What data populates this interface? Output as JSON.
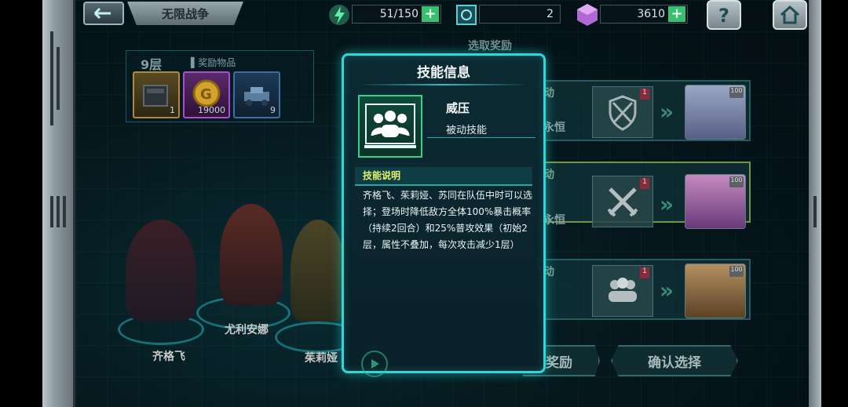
{
  "topbar": {
    "mode_title": "无限战争",
    "energy": "51/150",
    "scan_count": "2",
    "gems": "3610",
    "plus_label": "+"
  },
  "floor_panel": {
    "floor": "9层",
    "rewards_label": "▌奖励物品",
    "items": [
      {
        "icon": "ammo-crate-icon",
        "count": "1"
      },
      {
        "icon": "gold-coin-icon",
        "count": "19000"
      },
      {
        "icon": "tank-part-icon",
        "count": "9"
      }
    ]
  },
  "characters": [
    {
      "name": "齐格飞"
    },
    {
      "name": "尤利安娜"
    },
    {
      "name": "茱莉娅"
    }
  ],
  "choose_reward_header": "选取奖励",
  "choices": [
    {
      "title": "动",
      "sub": "永恒",
      "skill_icon": "crossed-sword-shield-icon"
    },
    {
      "title": "动",
      "sub": "永恒",
      "skill_icon": "crossed-swords-icon"
    },
    {
      "title": "动",
      "sub": "",
      "skill_icon": "group-icon"
    }
  ],
  "bottom_buttons": {
    "reward": "奖励",
    "confirm": "确认选择"
  },
  "modal": {
    "title": "技能信息",
    "skill_name": "威压",
    "skill_type": "被动技能",
    "desc_label": "技能说明",
    "description": "齐格飞、茱莉娅、苏同在队伍中时可以选择；登场时降低敌方全体100%暴击概率（持续2回合）和25%普攻效果（初始2层，属性不叠加，每次攻击减少1层）"
  },
  "colors": {
    "accent": "#31d6d6",
    "label_yellow": "#e3f26a",
    "plus_green": "#38c070"
  }
}
